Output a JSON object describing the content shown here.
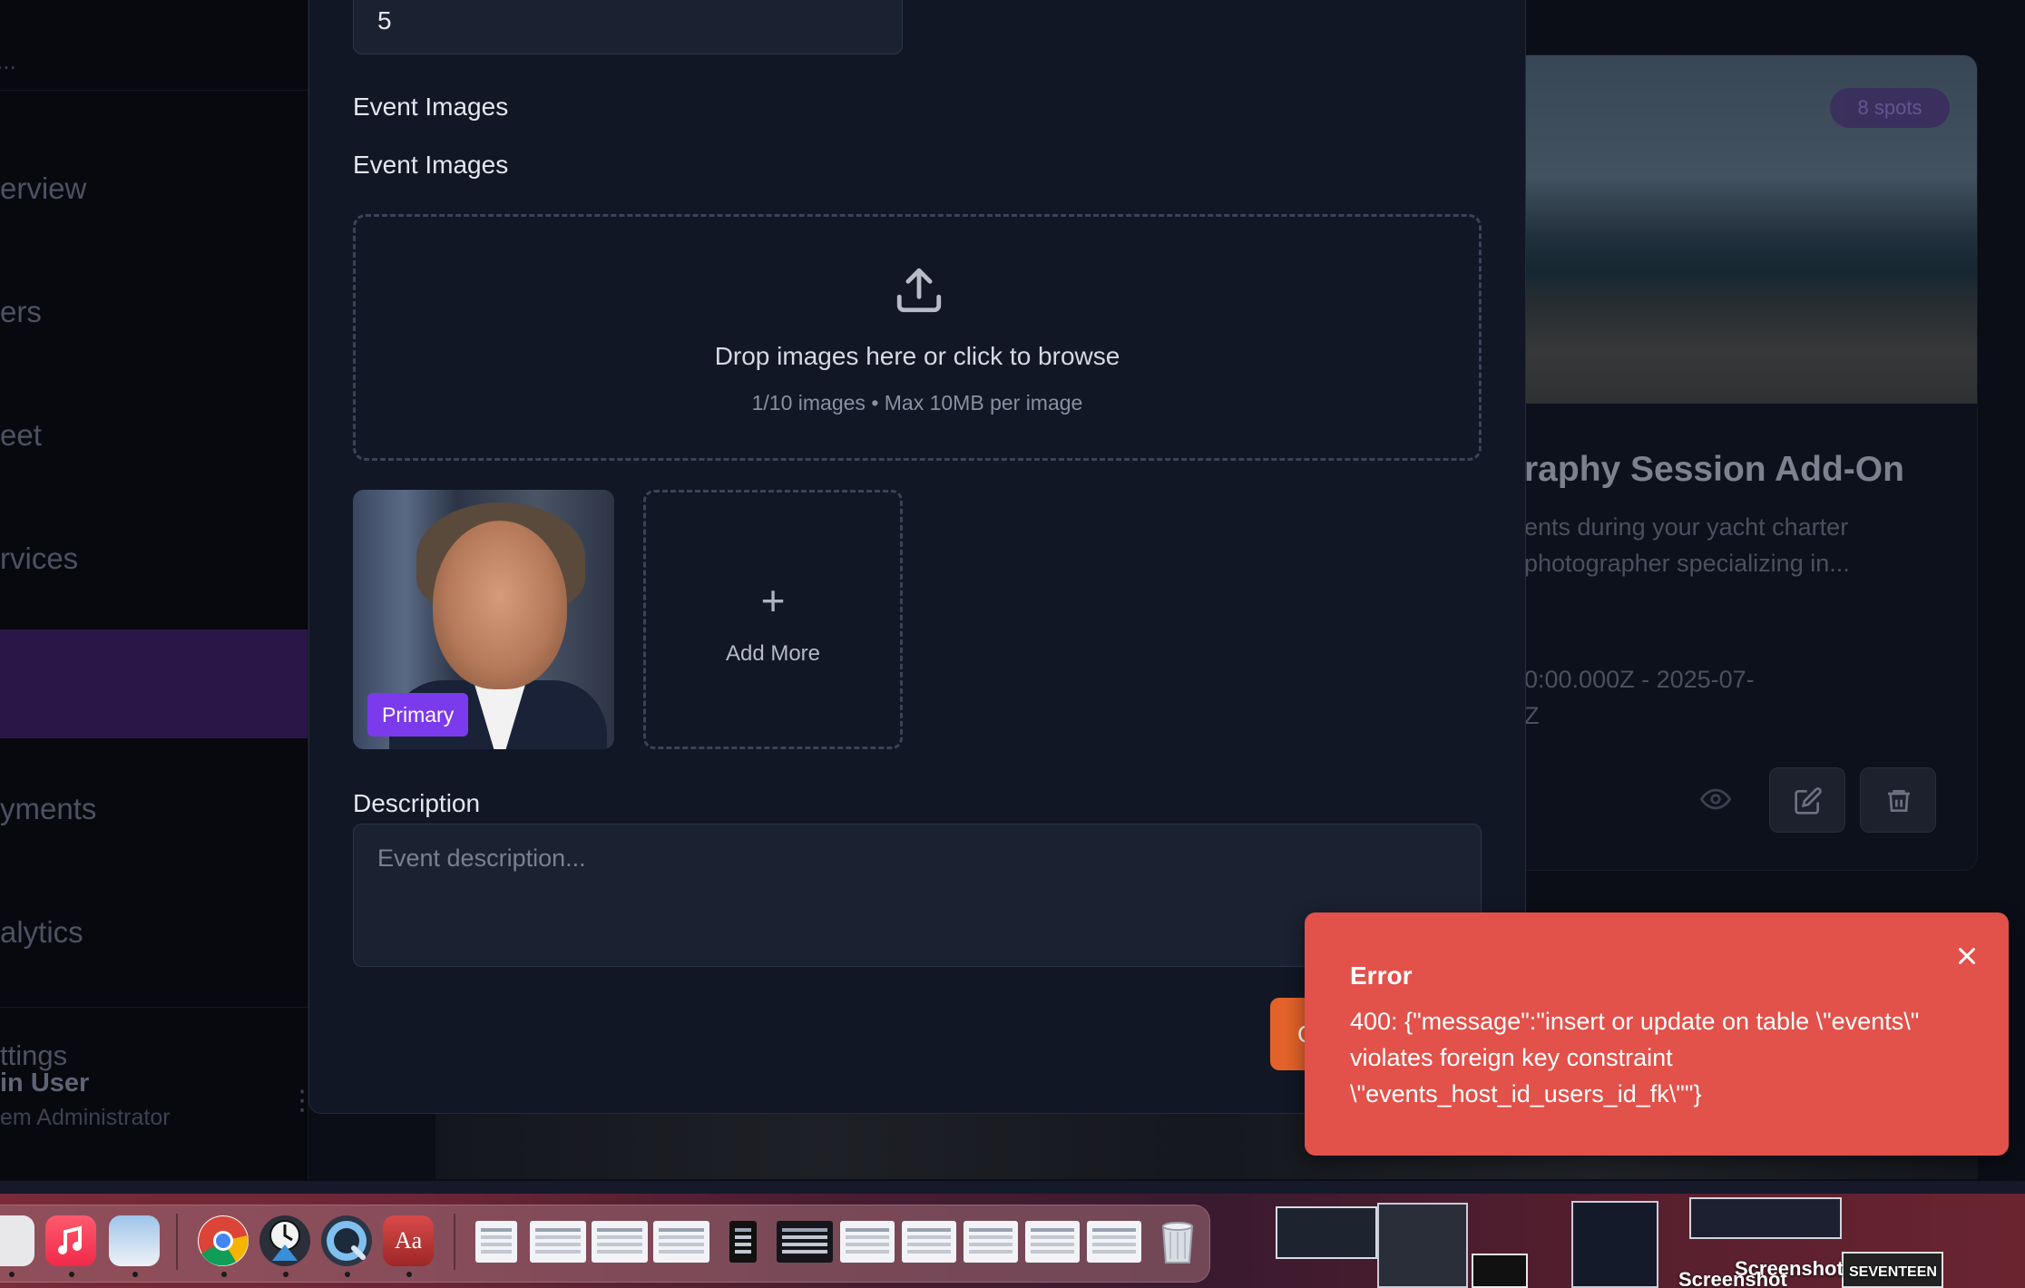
{
  "background": {
    "sidebar": {
      "search_fragment": "...",
      "nav_items": [
        "erview",
        "ers",
        "eet",
        "rvices",
        "yments",
        "alytics"
      ],
      "settings_label": "ttings",
      "user_name": "in User",
      "user_role": "em Administrator"
    },
    "event_card": {
      "badge": "8 spots",
      "title": "raphy Session Add-On",
      "desc_line1": "ents during your yacht charter",
      "desc_line2": "photographer specializing in...",
      "date_line1": "0:00.000Z - 2025-07-",
      "date_line2": "Z"
    }
  },
  "modal": {
    "max_attendees_value": "5",
    "section_label": "Event Images",
    "field_label": "Event Images",
    "dropzone": {
      "title": "Drop images here or click to browse",
      "subtitle": "1/10 images • Max 10MB per image"
    },
    "primary_tag": "Primary",
    "add_more_plus": "+",
    "add_more_label": "Add More",
    "description_label": "Description",
    "description_placeholder": "Event description...",
    "create_button_label": "C"
  },
  "toast": {
    "title": "Error",
    "message": "400: {\"message\":\"insert or update on table \\\"events\\\" violates foreign key constraint \\\"events_host_id_users_id_fk\\\"\"}",
    "accent": "#e2514a"
  },
  "dock": {
    "apps": [
      "Finder-like",
      "Music",
      "Preview",
      "Chrome",
      "Instruments",
      "QuickTime Player",
      "Dictionary"
    ],
    "desktop_labels": [
      "Screenshot",
      "Screenshot",
      "SEVENTEEN"
    ]
  },
  "colors": {
    "accent_purple": "#7c3aed",
    "accent_orange": "#e2622a",
    "modal_bg": "#111725"
  }
}
